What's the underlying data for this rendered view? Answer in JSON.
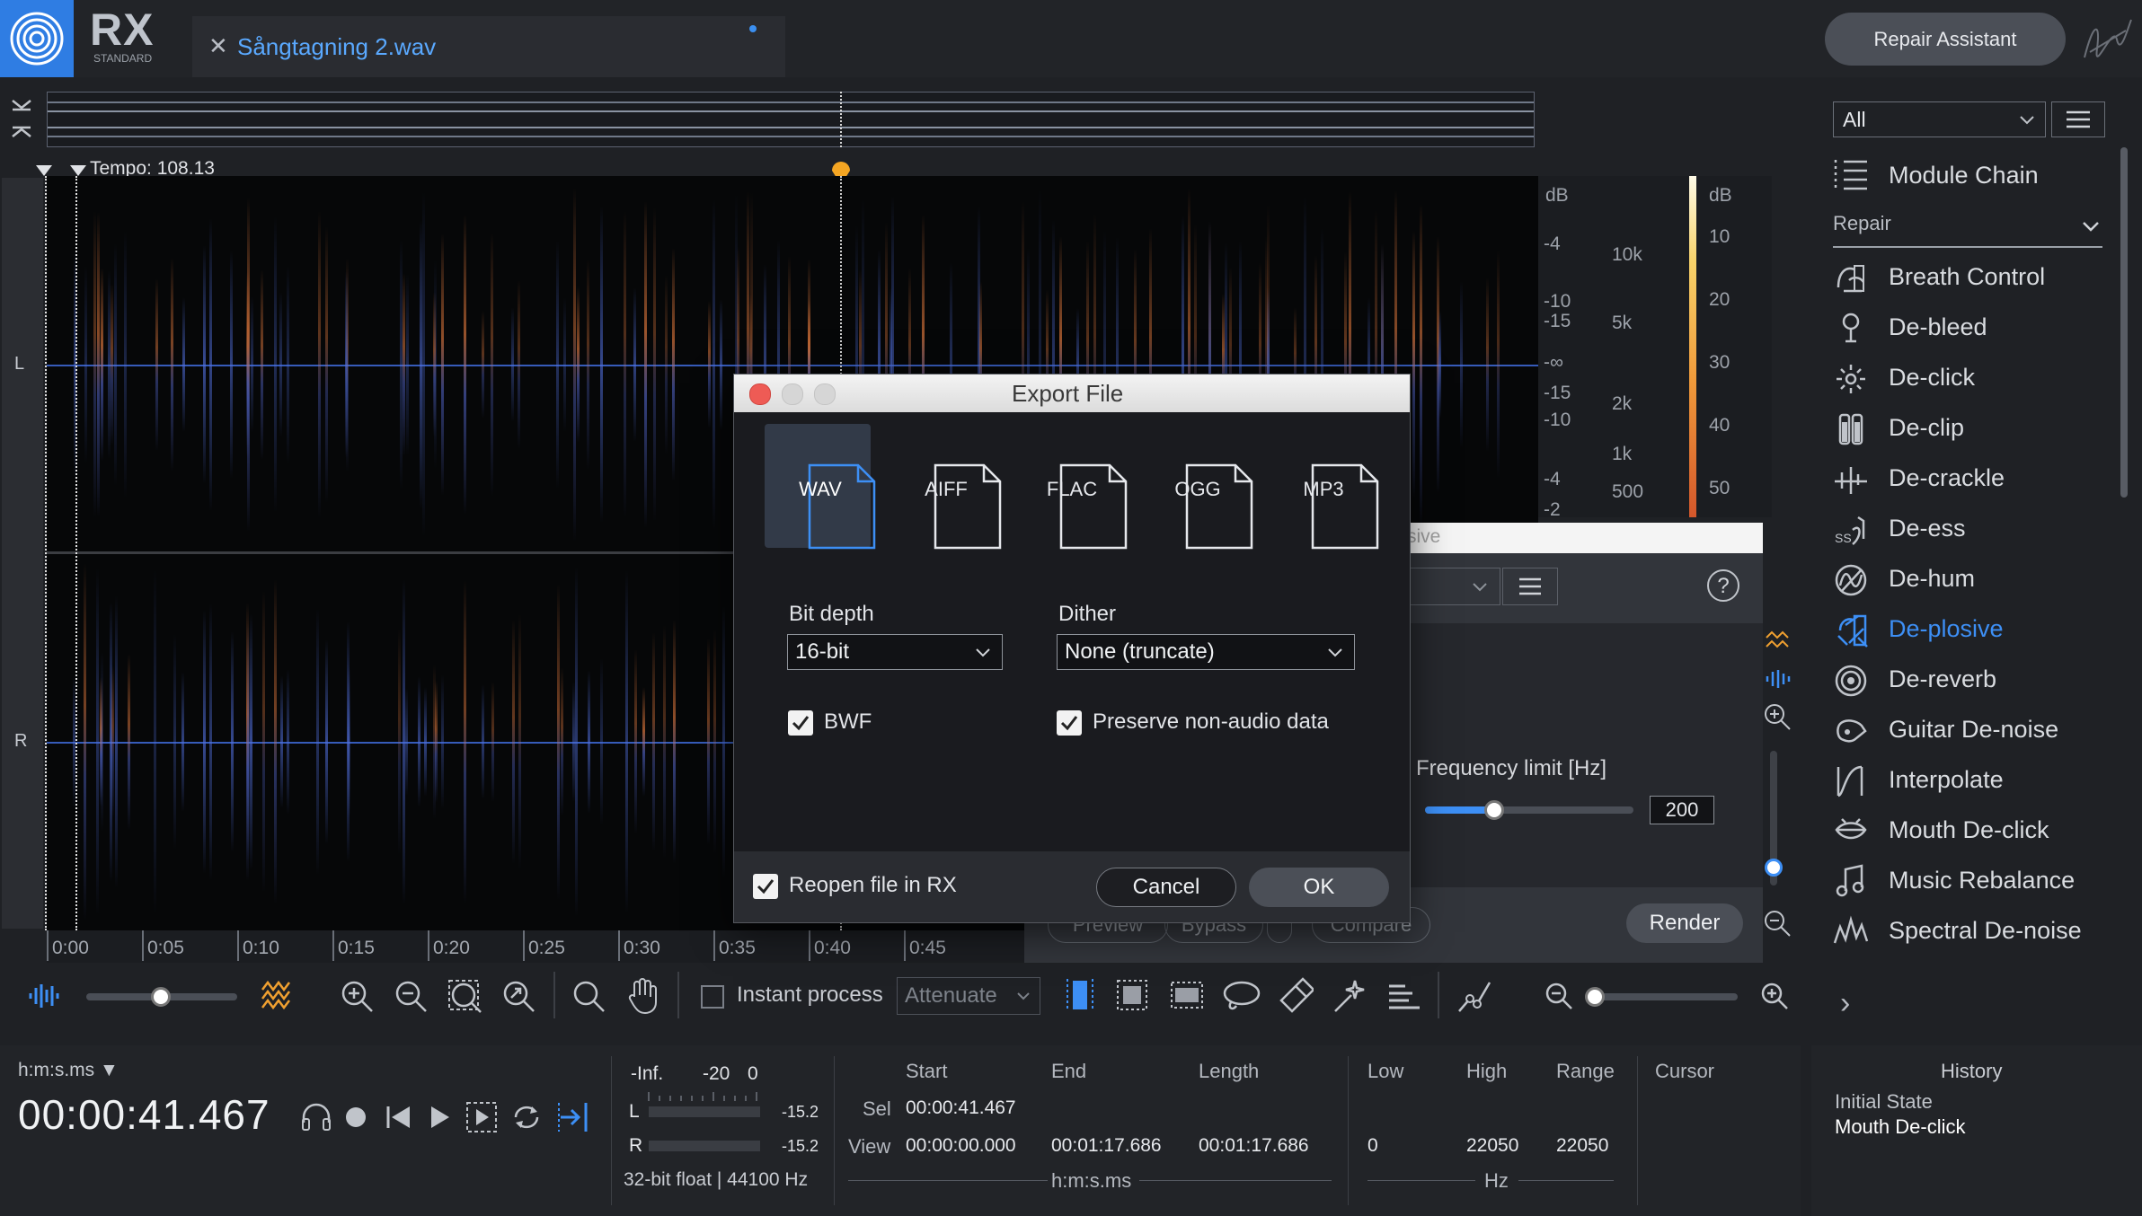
{
  "app": {
    "logo_text": "RX",
    "edition": "STANDARD",
    "repair_assistant_label": "Repair Assistant"
  },
  "tab": {
    "filename": "Sångtagning 2.wav",
    "close": "✕"
  },
  "tempo": {
    "label": "Tempo: 108.13"
  },
  "channels": {
    "left": "L",
    "right": "R"
  },
  "scales": {
    "db_left_header": "dB",
    "db_left": [
      "-4",
      "-10",
      "-15",
      "-∞",
      "-15",
      "-10",
      "-4",
      "-2"
    ],
    "freq": [
      "10k",
      "5k",
      "2k",
      "1k",
      "500"
    ],
    "db_right_header": "dB",
    "db_right": [
      "10",
      "20",
      "30",
      "40",
      "50"
    ]
  },
  "ruler": [
    "0:00",
    "0:05",
    "0:10",
    "0:15",
    "0:20",
    "0:25",
    "0:30",
    "0:35",
    "0:40",
    "0:45"
  ],
  "toolbar": {
    "instant_process": "Instant process",
    "attenuate": "Attenuate"
  },
  "status": {
    "time_format": "h:m:s.ms ▼",
    "timecode": "00:00:41.467",
    "meter_scale": [
      "-Inf.",
      "-20",
      "0"
    ],
    "meter_l_label": "L",
    "meter_r_label": "R",
    "meter_l_value": "-15.2",
    "meter_r_value": "-15.2",
    "format_info": "32-bit float | 44100 Hz",
    "col_start": "Start",
    "col_end": "End",
    "col_length": "Length",
    "row_sel": "Sel",
    "row_view": "View",
    "sel_start": "00:00:41.467",
    "view_start": "00:00:00.000",
    "view_end": "00:01:17.686",
    "view_length": "00:01:17.686",
    "time_unit": "h:m:s.ms",
    "col_low": "Low",
    "col_high": "High",
    "col_range": "Range",
    "low": "0",
    "high": "22050",
    "range": "22050",
    "freq_unit": "Hz",
    "col_cursor": "Cursor"
  },
  "right_panel": {
    "filter": "All",
    "module_chain": "Module Chain",
    "category": "Repair",
    "modules": [
      {
        "label": "Breath Control",
        "icon": "breath-icon"
      },
      {
        "label": "De-bleed",
        "icon": "de-bleed-icon"
      },
      {
        "label": "De-click",
        "icon": "de-click-icon"
      },
      {
        "label": "De-clip",
        "icon": "de-clip-icon"
      },
      {
        "label": "De-crackle",
        "icon": "de-crackle-icon"
      },
      {
        "label": "De-ess",
        "icon": "de-ess-icon"
      },
      {
        "label": "De-hum",
        "icon": "de-hum-icon"
      },
      {
        "label": "De-plosive",
        "icon": "de-plosive-icon",
        "active": true
      },
      {
        "label": "De-reverb",
        "icon": "de-reverb-icon"
      },
      {
        "label": "Guitar De-noise",
        "icon": "guitar-icon"
      },
      {
        "label": "Interpolate",
        "icon": "interpolate-icon"
      },
      {
        "label": "Mouth De-click",
        "icon": "mouth-icon"
      },
      {
        "label": "Music Rebalance",
        "icon": "music-icon"
      },
      {
        "label": "Spectral De-noise",
        "icon": "spectral-icon"
      }
    ]
  },
  "history": {
    "title": "History",
    "items": [
      "Initial State",
      "Mouth De-click"
    ]
  },
  "deplosive": {
    "title_fragment": "sive",
    "help": "?",
    "freq_label": "Frequency limit [Hz]",
    "freq_value": "200",
    "freq_fraction": 0.33,
    "preview": "Preview",
    "bypass": "Bypass",
    "compare": "Compare",
    "render": "Render"
  },
  "export": {
    "title": "Export File",
    "formats": [
      "WAV",
      "AIFF",
      "FLAC",
      "OGG",
      "MP3"
    ],
    "selected_format": "WAV",
    "bit_depth_label": "Bit depth",
    "bit_depth": "16-bit",
    "dither_label": "Dither",
    "dither": "None (truncate)",
    "bwf_label": "BWF",
    "bwf_checked": true,
    "preserve_label": "Preserve non-audio data",
    "preserve_checked": true,
    "reopen_label": "Reopen file in RX",
    "reopen_checked": true,
    "cancel": "Cancel",
    "ok": "OK"
  },
  "colors": {
    "accent": "#3d8ff5",
    "logo_bg": "#2f7de3",
    "marker": "#f5a623",
    "spectro_orange": "#d9743a",
    "spectro_blue": "#3f6ad8"
  }
}
